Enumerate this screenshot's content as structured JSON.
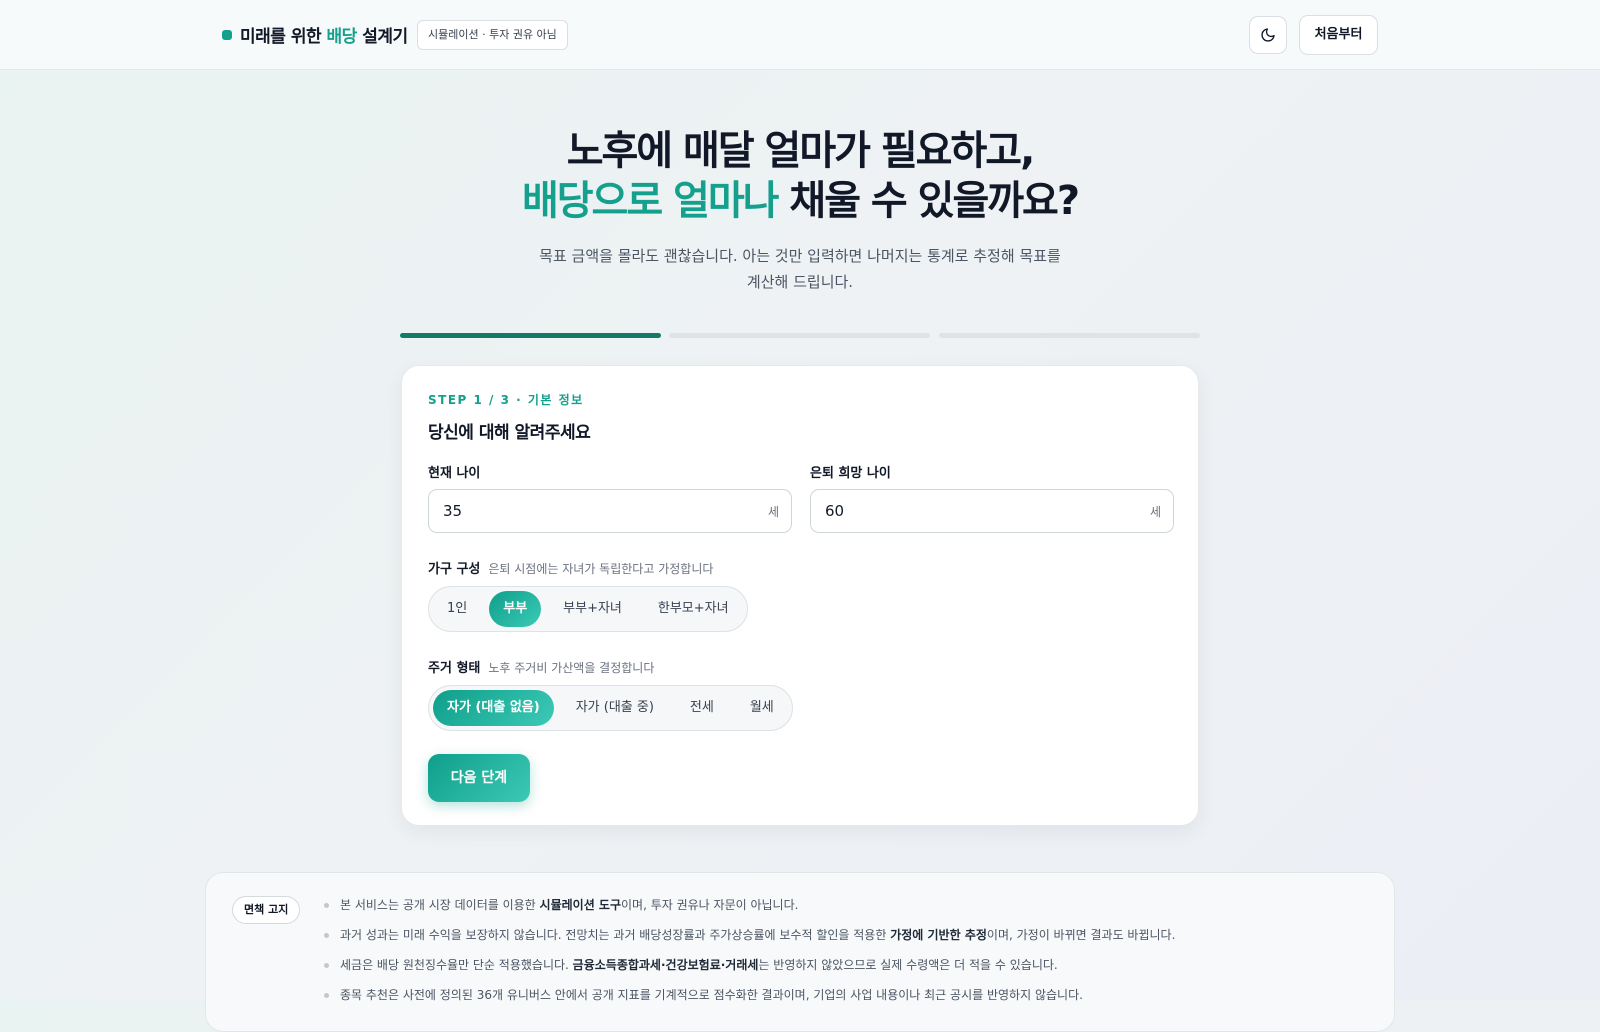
{
  "header": {
    "brand_prefix": "미래를 위한",
    "brand_accent": "배당",
    "brand_suffix": "설계기",
    "badge": "시뮬레이션 · 투자 권유 아님",
    "reset_label": "처음부터"
  },
  "hero": {
    "title_line1": "노후에 매달 얼마가 필요하고,",
    "title_line2_accent": "배당으로 얼마나",
    "title_line2_rest": "채울 수 있을까요?",
    "subtitle_line1": "목표 금액을 몰라도 괜찮습니다. 아는 것만 입력하면 나머지는 통계로 추정해 목표를",
    "subtitle_line2": "계산해 드립니다."
  },
  "progress": {
    "total_steps": 3,
    "current_step": 1
  },
  "form": {
    "step_label": "STEP 1 / 3 · 기본 정보",
    "title": "당신에 대해 알려주세요",
    "current_age": {
      "label": "현재 나이",
      "value": "35",
      "unit": "세"
    },
    "retire_age": {
      "label": "은퇴 희망 나이",
      "value": "60",
      "unit": "세"
    },
    "household": {
      "label": "가구 구성",
      "hint": "은퇴 시점에는 자녀가 독립한다고 가정합니다",
      "options": [
        "1인",
        "부부",
        "부부+자녀",
        "한부모+자녀"
      ],
      "selected": "부부"
    },
    "housing": {
      "label": "주거 형태",
      "hint": "노후 주거비 가산액을 결정합니다",
      "options": [
        "자가 (대출 없음)",
        "자가 (대출 중)",
        "전세",
        "월세"
      ],
      "selected": "자가 (대출 없음)"
    },
    "next_label": "다음 단계"
  },
  "disclaimer": {
    "badge": "면책 고지",
    "items": [
      {
        "pre": "본 서비스는 공개 시장 데이터를 이용한 ",
        "bold": "시뮬레이션 도구",
        "post": "이며, 투자 권유나 자문이 아닙니다."
      },
      {
        "pre": "과거 성과는 미래 수익을 보장하지 않습니다. 전망치는 과거 배당성장률과 주가상승률에 보수적 할인을 적용한 ",
        "bold": "가정에 기반한 추정",
        "post": "이며, 가정이 바뀌면 결과도 바뀝니다."
      },
      {
        "pre": "세금은 배당 원천징수율만 단순 적용했습니다. ",
        "bold": "금융소득종합과세·건강보험료·거래세",
        "post": "는 반영하지 않았으므로 실제 수령액은 더 적을 수 있습니다."
      },
      {
        "pre": "종목 추천은 사전에 정의된 36개 유니버스 안에서 공개 지표를 기계적으로 점수화한 결과이며, 기업의 사업 내용이나 최근 공시를 반영하지 않습니다.",
        "bold": "",
        "post": ""
      }
    ]
  },
  "colors": {
    "accent": "#14a08c",
    "accent_dark": "#117a68",
    "progress_inactive": "#dde3e6"
  },
  "icons": {
    "theme_toggle": "moon-icon"
  }
}
